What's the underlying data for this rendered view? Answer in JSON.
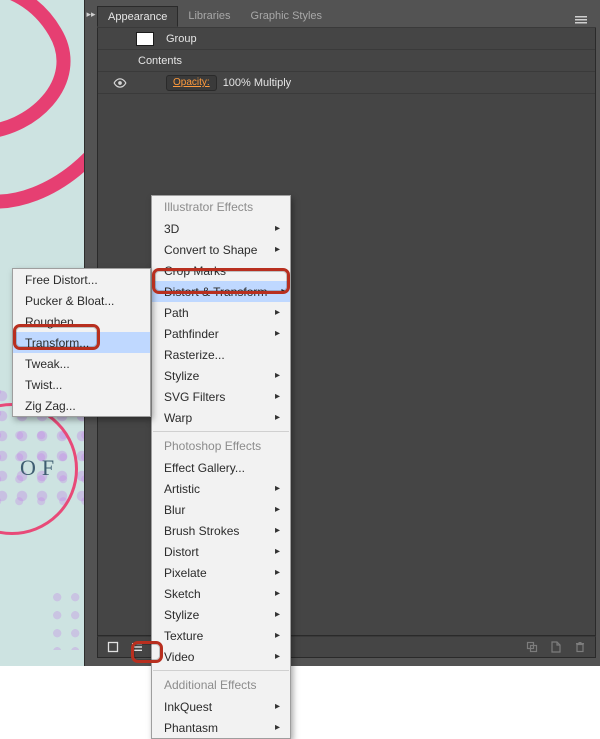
{
  "tabs": {
    "appearance": "Appearance",
    "libraries": "Libraries",
    "graphic_styles": "Graphic Styles"
  },
  "panel": {
    "group_label": "Group",
    "contents_label": "Contents",
    "opacity_label": "Opacity:",
    "opacity_value": "100% Multiply"
  },
  "footer": {
    "fx_label": "fx"
  },
  "fx_menu": {
    "heading_illustrator": "Illustrator Effects",
    "items_illustrator": [
      {
        "label": "3D",
        "submenu": true
      },
      {
        "label": "Convert to Shape",
        "submenu": true
      },
      {
        "label": "Crop Marks",
        "submenu": false
      },
      {
        "label": "Distort & Transform",
        "submenu": true,
        "highlight": true
      },
      {
        "label": "Path",
        "submenu": true
      },
      {
        "label": "Pathfinder",
        "submenu": true
      },
      {
        "label": "Rasterize...",
        "submenu": false
      },
      {
        "label": "Stylize",
        "submenu": true
      },
      {
        "label": "SVG Filters",
        "submenu": true
      },
      {
        "label": "Warp",
        "submenu": true
      }
    ],
    "heading_photoshop": "Photoshop Effects",
    "items_photoshop": [
      {
        "label": "Effect Gallery...",
        "submenu": false
      },
      {
        "label": "Artistic",
        "submenu": true
      },
      {
        "label": "Blur",
        "submenu": true
      },
      {
        "label": "Brush Strokes",
        "submenu": true
      },
      {
        "label": "Distort",
        "submenu": true
      },
      {
        "label": "Pixelate",
        "submenu": true
      },
      {
        "label": "Sketch",
        "submenu": true
      },
      {
        "label": "Stylize",
        "submenu": true
      },
      {
        "label": "Texture",
        "submenu": true
      },
      {
        "label": "Video",
        "submenu": true
      }
    ],
    "heading_additional": "Additional Effects",
    "items_additional": [
      {
        "label": "InkQuest",
        "submenu": true
      },
      {
        "label": "Phantasm",
        "submenu": true
      }
    ]
  },
  "distort_submenu": {
    "items": [
      {
        "label": "Free Distort...",
        "highlight": false
      },
      {
        "label": "Pucker & Bloat...",
        "highlight": false
      },
      {
        "label": "Roughen...",
        "highlight": false
      },
      {
        "label": "Transform...",
        "highlight": true
      },
      {
        "label": "Tweak...",
        "highlight": false
      },
      {
        "label": "Twist...",
        "highlight": false
      },
      {
        "label": "Zig Zag...",
        "highlight": false
      }
    ]
  },
  "art": {
    "of_text": "OF"
  },
  "icons": {
    "arrow_right": "▸",
    "flyout_arrows": "▸▸"
  }
}
